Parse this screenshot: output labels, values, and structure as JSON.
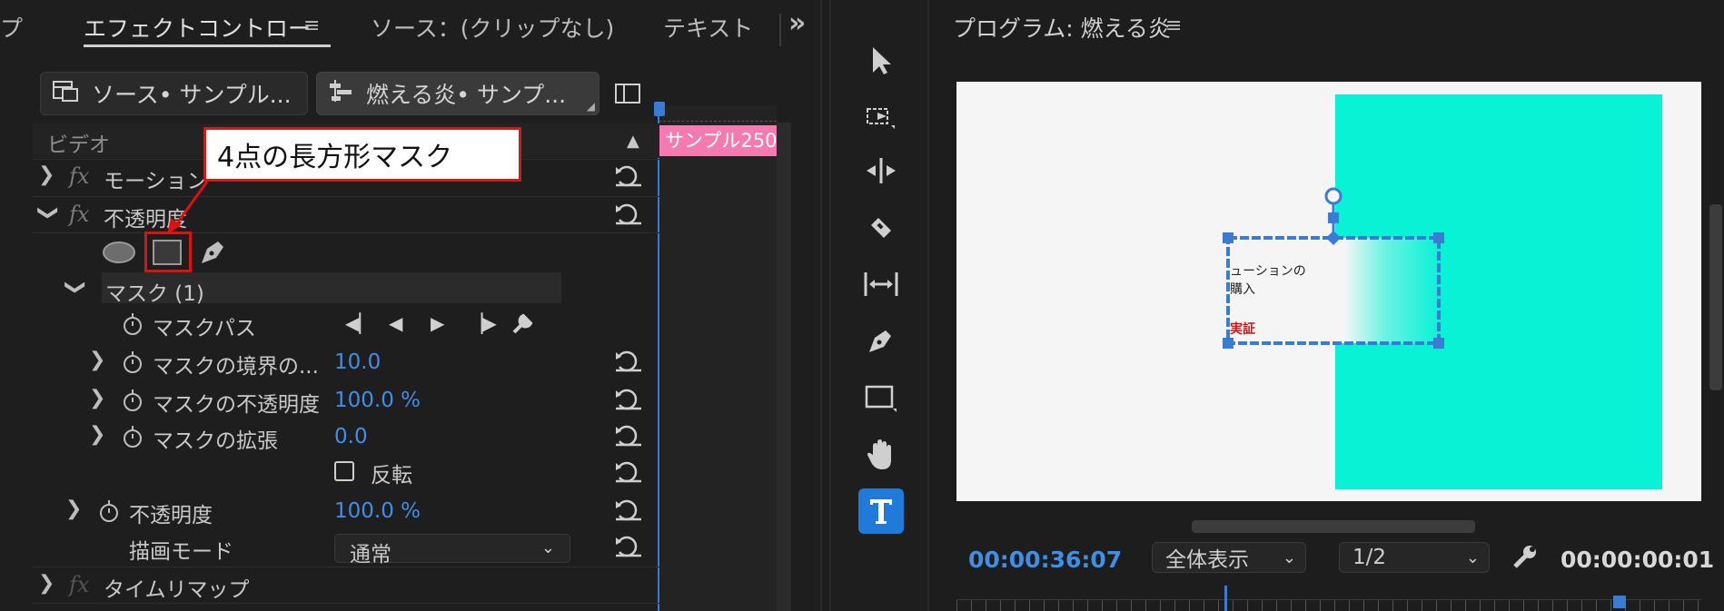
{
  "effect_controls": {
    "tabs": {
      "partial_left": "プ",
      "effect_controls": "エフェクトコントロー",
      "source": "ソース：(クリップなし)",
      "text": "テキスト",
      "overflow": "»"
    },
    "clip_source_label": "ソース• サンプル...",
    "clip_seq_label": "燃える炎• サンプ...",
    "section_video": "ビデオ",
    "timeline_clip_label": "サンプル250",
    "rows": {
      "motion": "モーション",
      "opacity": "不透明度",
      "mask": "マスク (1)",
      "mask_path": "マスクパス",
      "mask_feather": "マスクの境界の...",
      "mask_feather_value": "10.0",
      "mask_opacity": "マスクの不透明度",
      "mask_opacity_value": "100.0 %",
      "mask_expansion": "マスクの拡張",
      "mask_expansion_value": "0.0",
      "inverted": "反転",
      "opacity_inner": "不透明度",
      "opacity_inner_value": "100.0 %",
      "blend_mode": "描画モード",
      "blend_mode_value": "通常",
      "time_remap": "タイムリマップ"
    },
    "callout_text": "4点の長方形マスク"
  },
  "program_monitor": {
    "title": "プログラム: 燃える炎",
    "current_timecode": "00:00:36:07",
    "zoom_value": "全体表示",
    "resolution_value": "1/2",
    "duration_timecode": "00:00:00:01",
    "overlay_text_line1": "ューションの",
    "overlay_text_line2": "購入",
    "overlay_text_red": "実証"
  },
  "colors": {
    "accent_blue": "#3f8fe6",
    "active_tool": "#1f7ad9",
    "clip_pink": "#f47ab0",
    "cyan_frame": "#0af2d6",
    "callout_red": "#e01010"
  },
  "icons": {
    "tools": [
      "selection-tool-icon",
      "track-select-icon",
      "ripple-edit-icon",
      "razor-icon",
      "slip-icon",
      "pen-icon",
      "rectangle-icon",
      "hand-icon",
      "type-icon"
    ]
  }
}
